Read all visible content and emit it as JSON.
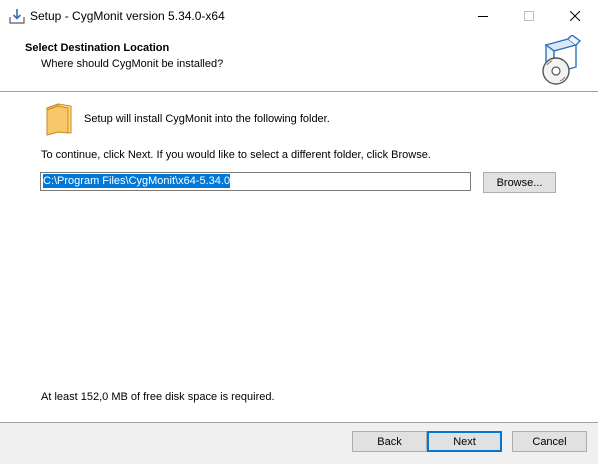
{
  "window": {
    "title": "Setup - CygMonit version 5.34.0-x64",
    "icons": {
      "app": "setup-install-icon",
      "minimize": "minimize-icon",
      "maximize": "maximize-icon",
      "close": "close-icon"
    }
  },
  "header": {
    "title": "Select Destination Location",
    "subtitle": "Where should CygMonit be installed?",
    "image_icon": "setup-box-disc-icon"
  },
  "content": {
    "folder_icon": "folder-icon",
    "intro": "Setup will install CygMonit into the following folder.",
    "instruction": "To continue, click Next. If you would like to select a different folder, click Browse.",
    "path_value": "C:\\Program Files\\CygMonit\\x64-5.34.0",
    "browse_label": "Browse...",
    "disk_space": "At least 152,0 MB of free disk space is required."
  },
  "footer": {
    "back_label": "Back",
    "next_label": "Next",
    "cancel_label": "Cancel"
  },
  "colors": {
    "selection": "#0078d7",
    "default_button_border": "#0078d7",
    "panel_bg": "#ffffff",
    "footer_bg": "#f0f0f0"
  }
}
